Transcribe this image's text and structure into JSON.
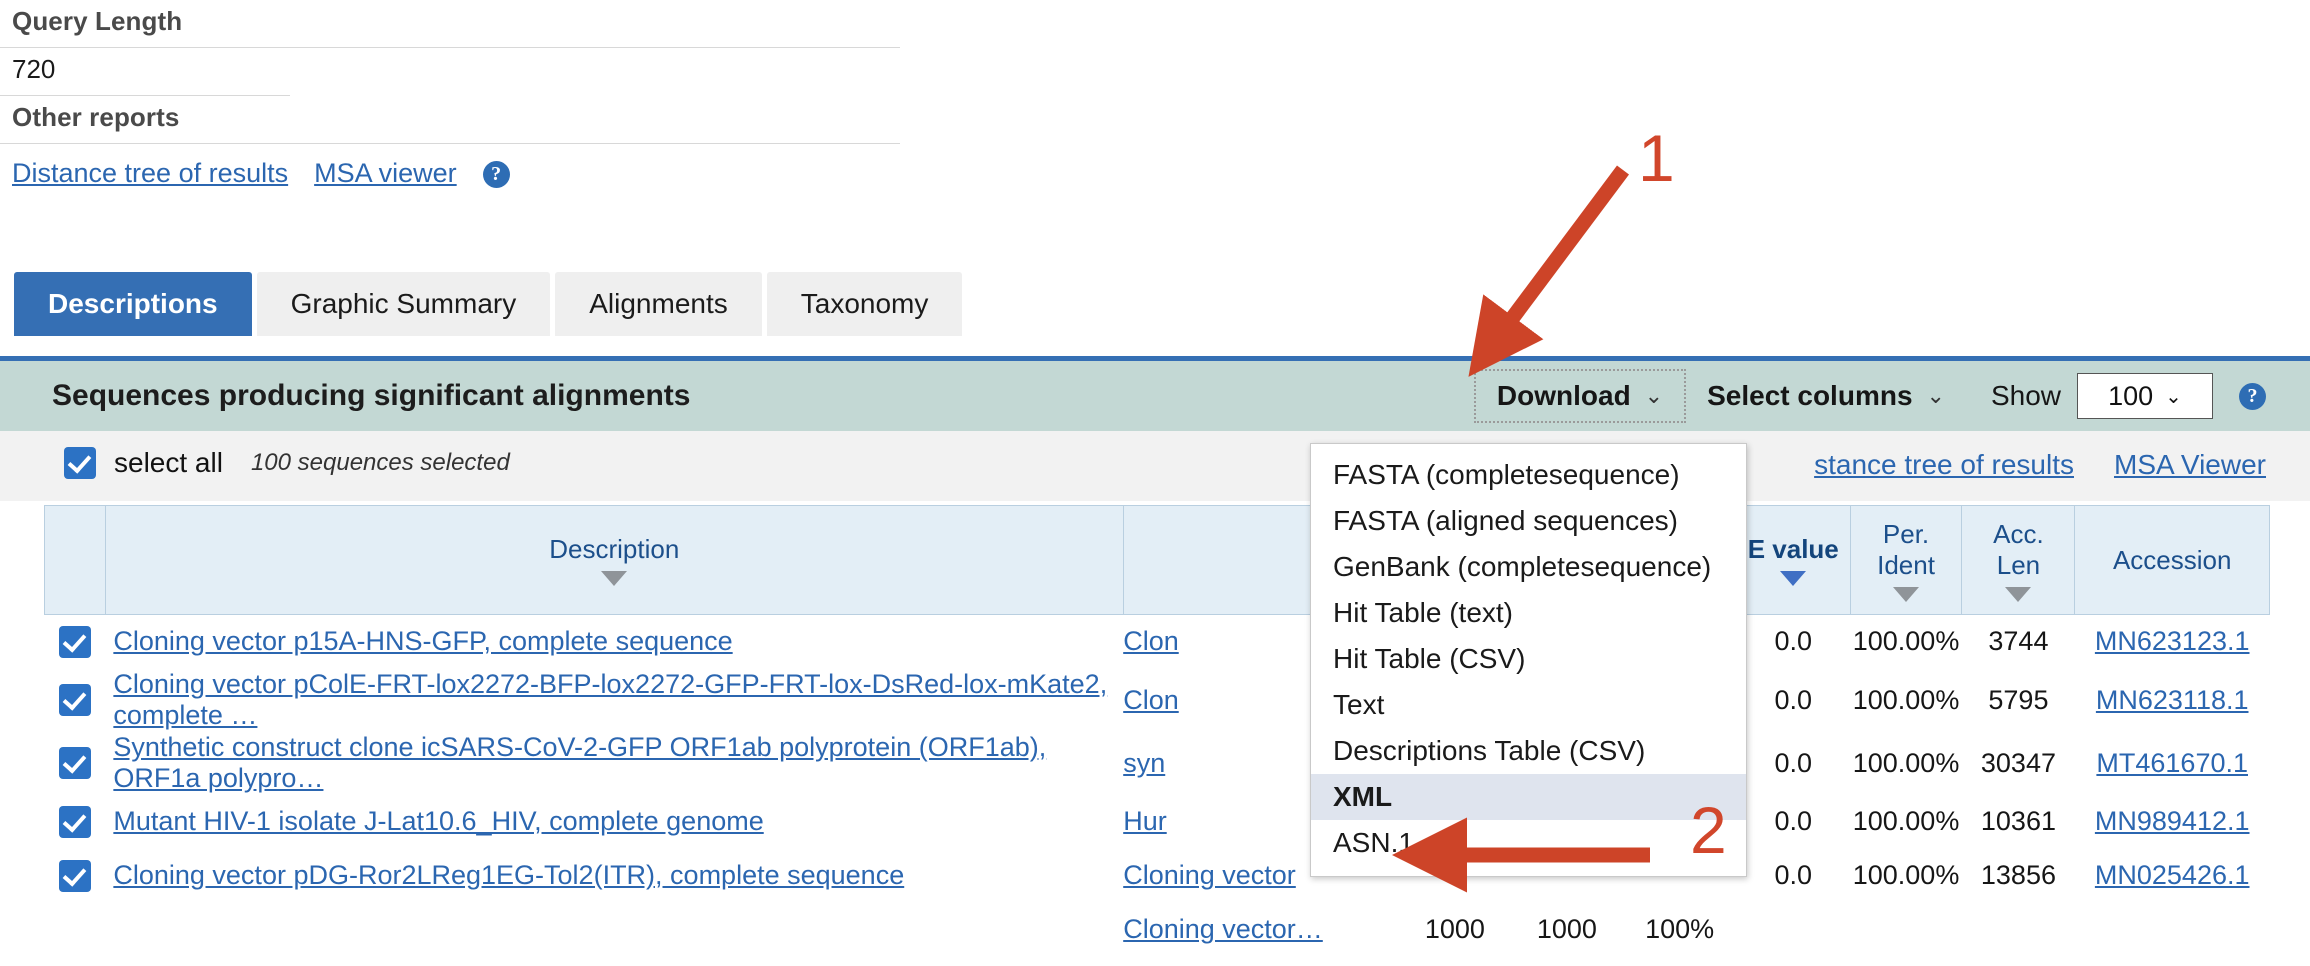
{
  "summary": {
    "query_length_label": "Query Length",
    "query_length_value": "720",
    "other_reports_label": "Other reports",
    "links": [
      {
        "label": "Distance tree of results"
      },
      {
        "label": "MSA viewer"
      }
    ],
    "help_icon": "help-icon",
    "help_glyph": "?"
  },
  "tabs": [
    {
      "label": "Descriptions",
      "active": true
    },
    {
      "label": "Graphic Summary",
      "active": false
    },
    {
      "label": "Alignments",
      "active": false
    },
    {
      "label": "Taxonomy",
      "active": false
    }
  ],
  "results_header": {
    "title": "Sequences producing significant alignments",
    "download_label": "Download",
    "select_columns_label": "Select columns",
    "show_label": "Show",
    "show_value": "100",
    "chevron_glyph": "⌄",
    "caret_glyph": "⌄",
    "help_glyph": "?"
  },
  "select_all": {
    "label": "select all",
    "count_text": "100 sequences selected",
    "checked": true,
    "links": [
      {
        "label": "stance tree of results"
      },
      {
        "label": "MSA Viewer"
      }
    ]
  },
  "download_menu": {
    "items": [
      {
        "label": "FASTA (completesequence)",
        "highlighted": false
      },
      {
        "label": "FASTA (aligned sequences)",
        "highlighted": false
      },
      {
        "label": "GenBank (completesequence)",
        "highlighted": false
      },
      {
        "label": "Hit Table (text)",
        "highlighted": false
      },
      {
        "label": "Hit Table (CSV)",
        "highlighted": false
      },
      {
        "label": "Text",
        "highlighted": false
      },
      {
        "label": "Descriptions Table (CSV)",
        "highlighted": false
      },
      {
        "label": "XML",
        "highlighted": true
      },
      {
        "label": "ASN.1",
        "highlighted": false
      }
    ]
  },
  "table": {
    "columns": [
      {
        "label": "",
        "sort": "none",
        "key": "check"
      },
      {
        "label": "Description",
        "sort": "inactive",
        "key": "description"
      },
      {
        "label": "",
        "sort": "none",
        "key": "scientific_name"
      },
      {
        "label": "",
        "sort": "none",
        "key": "max_score"
      },
      {
        "label": "",
        "sort": "none",
        "key": "total_score"
      },
      {
        "label": "",
        "sort": "none",
        "key": "query_cover"
      },
      {
        "label": "E value",
        "sort": "active",
        "key": "e_value"
      },
      {
        "label": "Per. Ident",
        "sort": "inactive",
        "key": "per_ident"
      },
      {
        "label": "Acc. Len",
        "sort": "inactive",
        "key": "acc_len"
      },
      {
        "label": "Accession",
        "sort": "none",
        "key": "accession"
      }
    ],
    "rows": [
      {
        "checked": true,
        "description": "Cloning vector p15A-HNS-GFP, complete sequence",
        "scientific_name": "Clon",
        "e_value": "0.0",
        "per_ident": "100.00%",
        "acc_len": "3744",
        "accession": "MN623123.1"
      },
      {
        "checked": true,
        "description": "Cloning vector pColE-FRT-lox2272-BFP-lox2272-GFP-FRT-lox-DsRed-lox-mKate2, complete …",
        "scientific_name": "Clon",
        "e_value": "0.0",
        "per_ident": "100.00%",
        "acc_len": "5795",
        "accession": "MN623118.1"
      },
      {
        "checked": true,
        "description": "Synthetic construct clone icSARS-CoV-2-GFP ORF1ab polyprotein (ORF1ab), ORF1a polypro…",
        "scientific_name": "syn",
        "e_value": "0.0",
        "per_ident": "100.00%",
        "acc_len": "30347",
        "accession": "MT461670.1"
      },
      {
        "checked": true,
        "description": "Mutant HIV-1 isolate J-Lat10.6_HIV, complete genome",
        "scientific_name": "Hur",
        "e_value": "0.0",
        "per_ident": "100.00%",
        "acc_len": "10361",
        "accession": "MN989412.1"
      },
      {
        "checked": true,
        "description": "Cloning vector pDG-Ror2LReg1EG-Tol2(ITR), complete sequence",
        "scientific_name": "Cloning vector",
        "e_value": "0.0",
        "per_ident": "100.00%",
        "acc_len": "13856",
        "accession": "MN025426.1"
      }
    ],
    "partial_row": {
      "scientific_name": "Cloning vector…",
      "max_score": "1000",
      "total_score": "1000",
      "query_cover": "100%"
    }
  },
  "annotations": [
    {
      "number": "1",
      "target": "download-button",
      "color": "#cd4428"
    },
    {
      "number": "2",
      "target": "xml-menu-item",
      "color": "#cd4428"
    }
  ],
  "colors": {
    "tab_active": "#356fb4",
    "results_header_bg": "#c3d8d4",
    "link": "#2b66b0",
    "checkbox": "#2c72c4",
    "annotation": "#cd4428",
    "table_header_bg": "#e3eef6",
    "menu_highlight": "#dfe4ee"
  }
}
